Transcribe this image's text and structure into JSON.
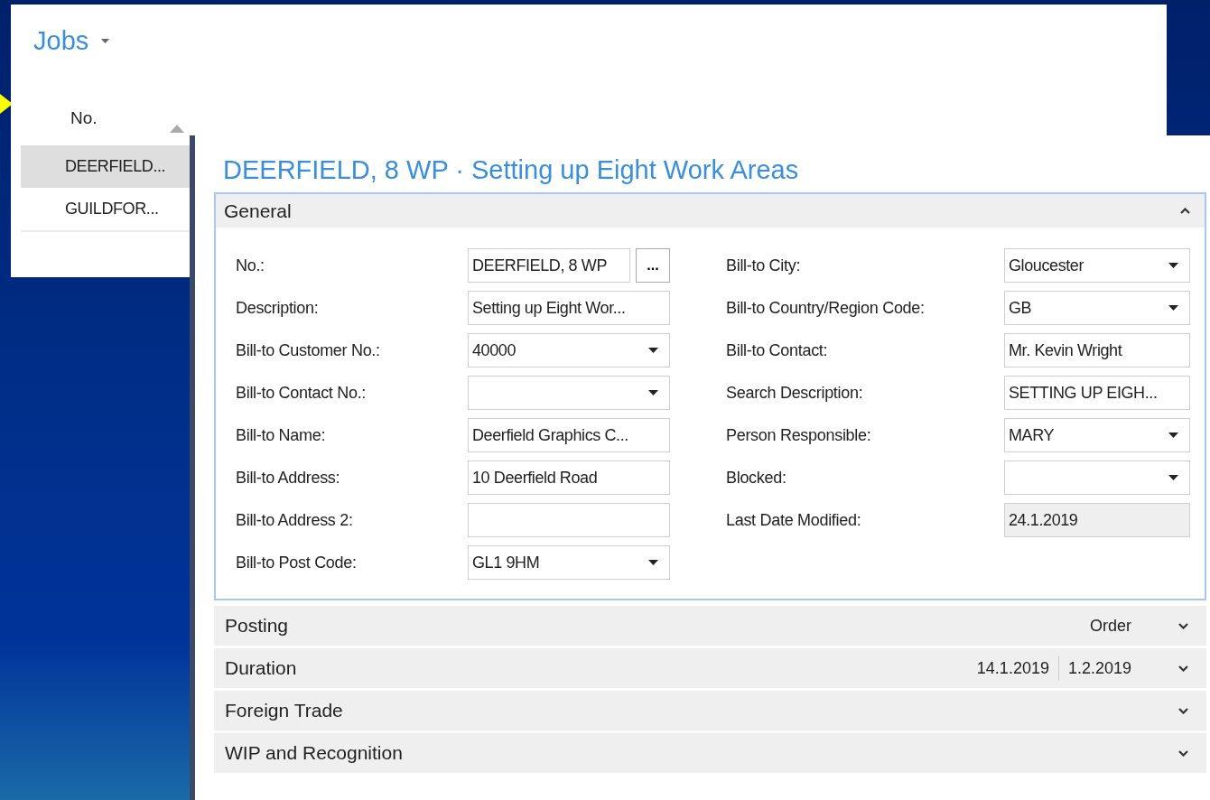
{
  "list_window": {
    "title": "Jobs",
    "columns": [
      {
        "label": "No.",
        "sorted": true
      }
    ],
    "rows": [
      {
        "no": "DEERFIELD...",
        "selected": true
      },
      {
        "no": "GUILDFOR...",
        "selected": false
      }
    ]
  },
  "card_window": {
    "title": "DEERFIELD, 8 WP · Setting up Eight Work Areas",
    "general": {
      "title": "General",
      "expanded": true,
      "left_fields": [
        {
          "label": "No.:",
          "value": "DEERFIELD, 8 WP",
          "kind": "assist",
          "assist_label": "..."
        },
        {
          "label": "Description:",
          "value": "Setting up Eight Wor...",
          "kind": "text"
        },
        {
          "label": "Bill-to Customer No.:",
          "value": "40000",
          "kind": "dropdown"
        },
        {
          "label": "Bill-to Contact No.:",
          "kind": "dropdown"
        },
        {
          "label": "Bill-to Name:",
          "value": "Deerfield Graphics C...",
          "kind": "text"
        },
        {
          "label": "Bill-to Address:",
          "value": "10 Deerfield Road",
          "kind": "text"
        },
        {
          "label": "Bill-to Address 2:",
          "kind": "text"
        },
        {
          "label": "Bill-to Post Code:",
          "value": "GL1 9HM",
          "kind": "dropdown"
        }
      ],
      "right_fields": [
        {
          "label": "Bill-to City:",
          "value": "Gloucester",
          "kind": "dropdown"
        },
        {
          "label": "Bill-to Country/Region Code:",
          "value": "GB",
          "kind": "dropdown"
        },
        {
          "label": "Bill-to Contact:",
          "value": "Mr. Kevin Wright",
          "kind": "text"
        },
        {
          "label": "Search Description:",
          "value": "SETTING UP EIGH...",
          "kind": "text"
        },
        {
          "label": "Person Responsible:",
          "value": "MARY",
          "kind": "dropdown"
        },
        {
          "label": "Blocked:",
          "kind": "dropdown"
        },
        {
          "label": "Last Date Modified:",
          "value": "24.1.2019",
          "kind": "readonly"
        }
      ]
    },
    "fasttabs": [
      {
        "title": "Posting",
        "expanded": false,
        "summary": [
          "Order"
        ]
      },
      {
        "title": "Duration",
        "expanded": false,
        "summary": [
          "14.1.2019",
          "1.2.2019"
        ]
      },
      {
        "title": "Foreign Trade",
        "expanded": false
      },
      {
        "title": "WIP and Recognition",
        "expanded": false
      }
    ]
  }
}
